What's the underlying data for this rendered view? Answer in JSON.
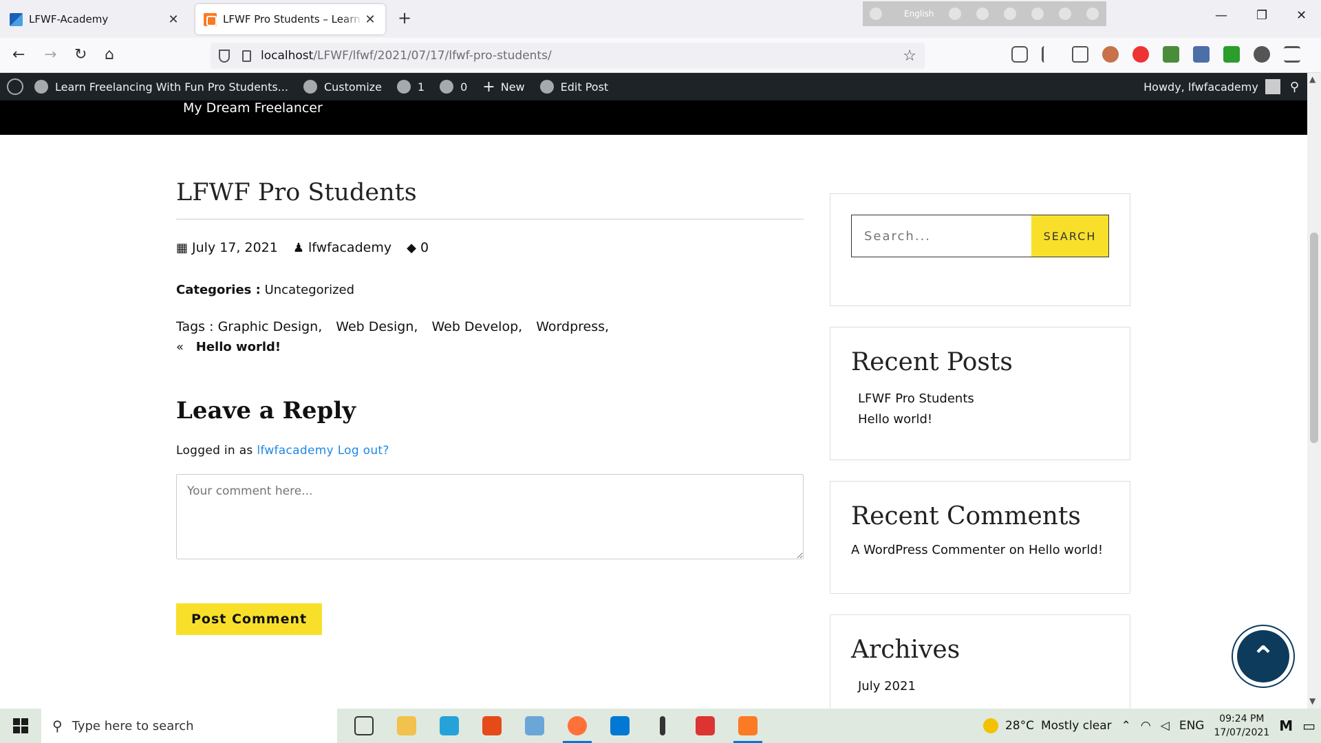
{
  "browser": {
    "tabs": [
      {
        "title": "LFWF-Academy",
        "active": false
      },
      {
        "title": "LFWF Pro Students – Learn Freelancing With Fun",
        "active": true
      }
    ],
    "url_host": "localhost",
    "url_path": "/LFWF/lfwf/2021/07/17/lfwf-pro-students/",
    "ext_language": "English"
  },
  "adminbar": {
    "site_name": "Learn Freelancing With Fun Pro Students...",
    "customize": "Customize",
    "updates": "1",
    "comments": "0",
    "new": "New",
    "edit": "Edit Post",
    "howdy": "Howdy, lfwfacademy"
  },
  "site": {
    "tagline": "My Dream Freelancer"
  },
  "post": {
    "title": "LFWF Pro Students",
    "date": "July 17, 2021",
    "author": "lfwfacademy",
    "comment_count": "0",
    "categories_label": "Categories :",
    "category": "Uncategorized",
    "tags_label": "Tags :",
    "tags": [
      "Graphic Design,",
      "Web Design,",
      "Web Develop,",
      "Wordpress,"
    ],
    "prev_arrow": "«",
    "prev_title": "Hello world!"
  },
  "reply": {
    "title": "Leave a Reply",
    "logged_in_prefix": "Logged in as",
    "user": "lfwfacademy",
    "logout": "Log out?",
    "placeholder": "Your comment here...",
    "submit": "Post Comment"
  },
  "sidebar": {
    "search_placeholder": "Search...",
    "search_button": "SEARCH",
    "recent_posts_title": "Recent Posts",
    "recent_posts": [
      "LFWF Pro Students",
      "Hello world!"
    ],
    "recent_comments_title": "Recent Comments",
    "recent_comment_author": "A WordPress Commenter",
    "recent_comment_on": "on",
    "recent_comment_post": "Hello world!",
    "archives_title": "Archives",
    "archives": [
      "July 2021"
    ]
  },
  "taskbar": {
    "search_placeholder": "Type here to search",
    "temperature": "28°C",
    "weather": "Mostly clear",
    "language": "ENG",
    "time": "09:24 PM",
    "date": "17/07/2021"
  },
  "colors": {
    "accent_yellow": "#f8e02a",
    "adminbar": "#1d2327",
    "link": "#1e88e5",
    "totop": "#0d3b5c"
  }
}
